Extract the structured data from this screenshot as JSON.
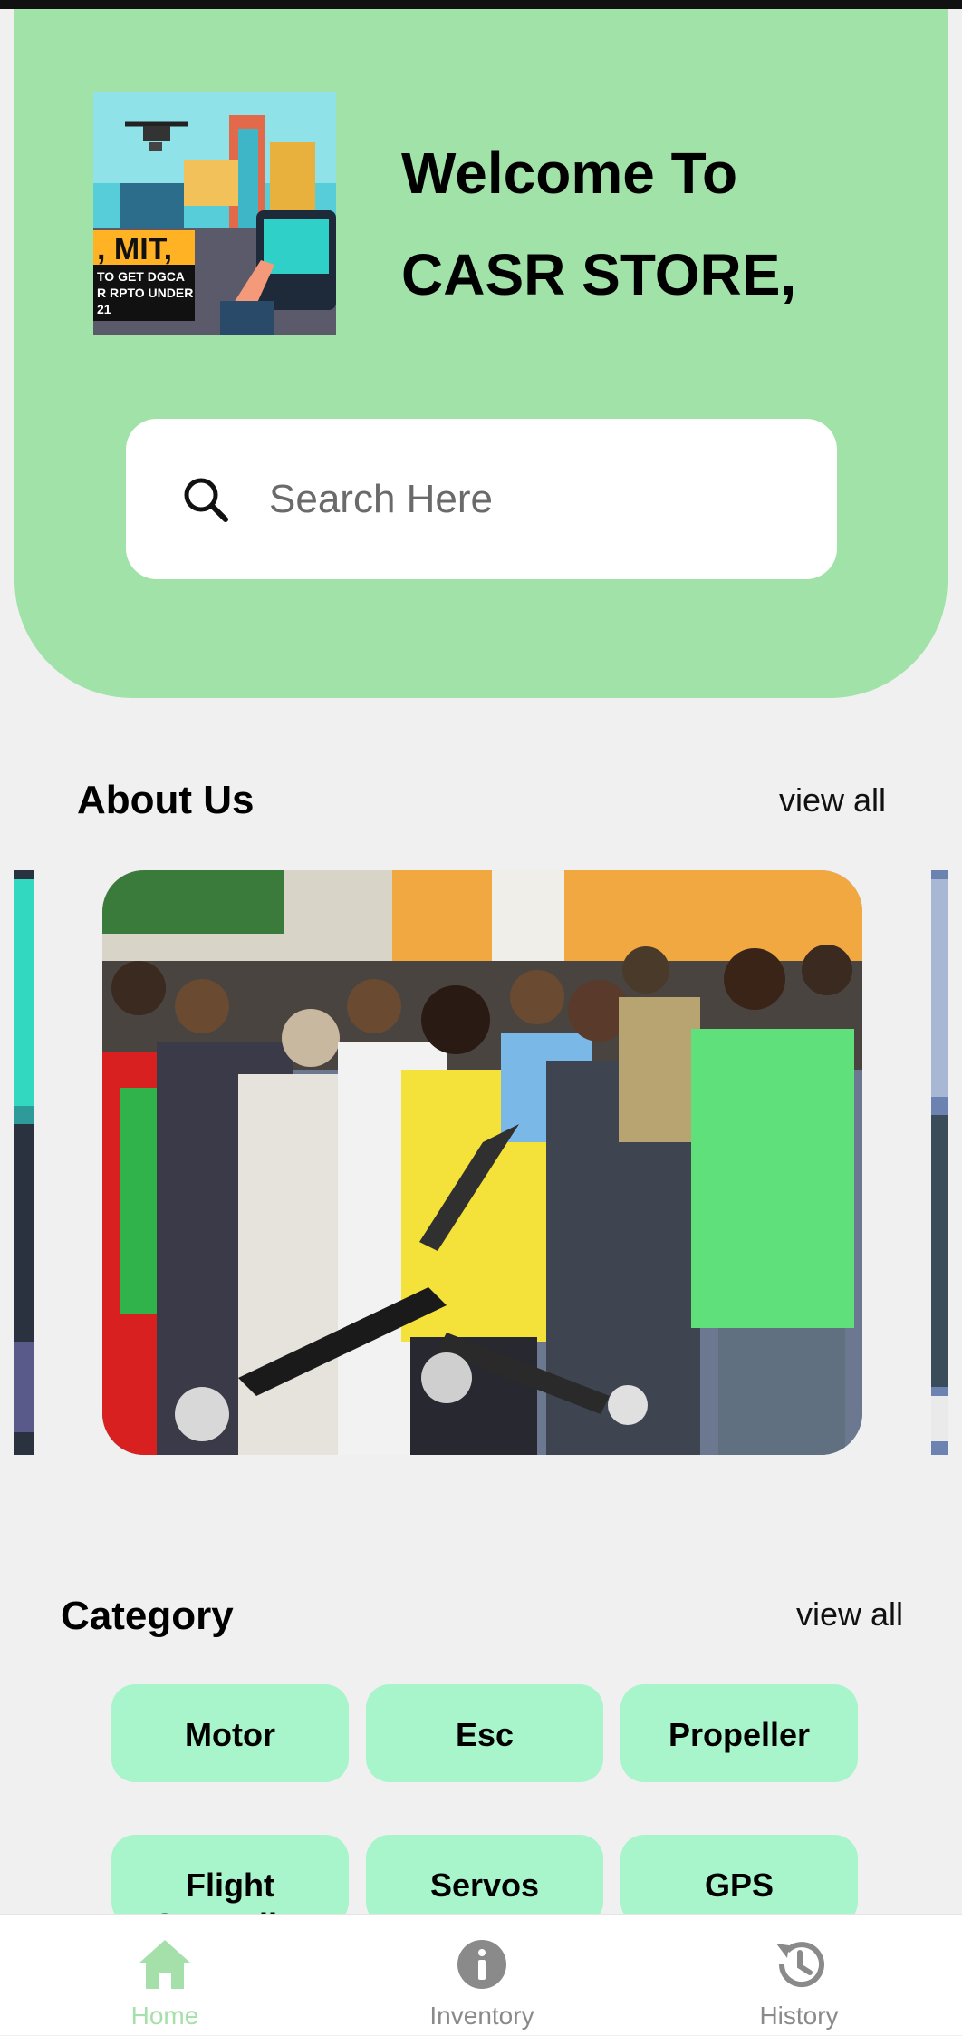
{
  "header": {
    "welcome_line1": "Welcome To",
    "welcome_line2": "CASR STORE,",
    "banner_text_big": ", MIT,",
    "banner_text_small1": "TO GET DGCA",
    "banner_text_small2": "R RPTO UNDER",
    "banner_text_small3": "21"
  },
  "search": {
    "placeholder": "Search Here",
    "icon": "search-icon"
  },
  "about": {
    "title": "About Us",
    "view_all": "view all"
  },
  "category": {
    "title": "Category",
    "view_all": "view all",
    "items": [
      "Motor",
      "Esc",
      "Propeller",
      "Flight Controller",
      "Servos",
      "GPS"
    ]
  },
  "nav": {
    "items": [
      {
        "label": "Home",
        "icon": "home-icon",
        "active": true
      },
      {
        "label": "Inventory",
        "icon": "info-icon",
        "active": false
      },
      {
        "label": "History",
        "icon": "history-icon",
        "active": false
      }
    ]
  },
  "colors": {
    "header_bg": "#a0e2a8",
    "chip_bg": "#a8f4cb",
    "nav_active": "#a5dfa9",
    "nav_inactive": "#8a8a8a"
  }
}
